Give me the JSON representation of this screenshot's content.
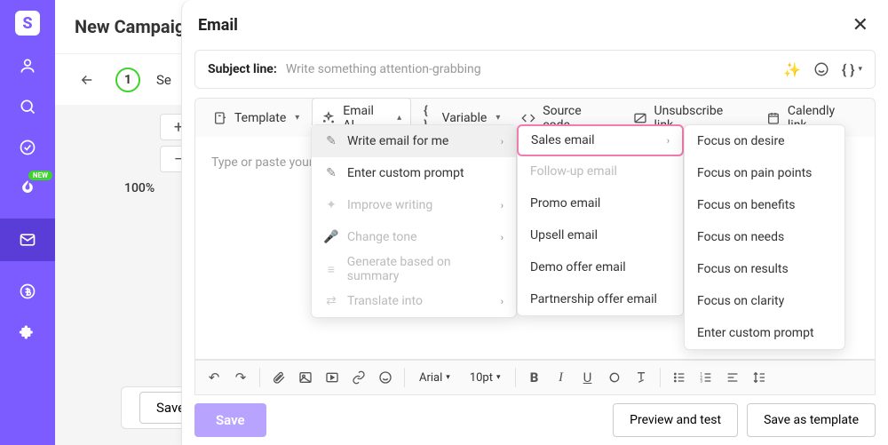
{
  "sidebar": {
    "logo": "S",
    "new_badge": "NEW"
  },
  "underlay": {
    "title": "New Campaign",
    "step_num": "1",
    "step_label": "Se",
    "zoom_label": "100%",
    "save": "Save"
  },
  "modal": {
    "title": "Email",
    "subject_label": "Subject line:",
    "subject_placeholder": "Write something attention-grabbing",
    "toolbar": {
      "template": "Template",
      "email_ai": "Email AI",
      "variable": "Variable",
      "source_code": "Source code",
      "unsubscribe": "Unsubscribe link",
      "calendly": "Calendly link"
    },
    "editor_placeholder": "Type or paste your",
    "footer": {
      "save": "Save",
      "preview": "Preview and test",
      "save_template": "Save as template"
    },
    "bottom_toolbar": {
      "font": "Arial",
      "size": "10pt"
    }
  },
  "menu1": {
    "items": [
      {
        "label": "Write email for me",
        "icon": "✎",
        "arrow": true,
        "highlighted": true
      },
      {
        "label": "Enter custom prompt",
        "icon": "✎",
        "arrow": false
      },
      {
        "label": "Improve writing",
        "icon": "✦",
        "arrow": true,
        "disabled": true
      },
      {
        "label": "Change tone",
        "icon": "🎤",
        "arrow": true,
        "disabled": true
      },
      {
        "label": "Generate based on summary",
        "icon": "≡",
        "arrow": false,
        "disabled": true
      },
      {
        "label": "Translate into",
        "icon": "⇄",
        "arrow": true,
        "disabled": true
      }
    ]
  },
  "menu2": {
    "items": [
      {
        "label": "Sales email",
        "arrow": true,
        "pink": true
      },
      {
        "label": "Follow-up email",
        "disabled": true
      },
      {
        "label": "Promo email"
      },
      {
        "label": "Upsell email"
      },
      {
        "label": "Demo offer email"
      },
      {
        "label": "Partnership offer email"
      }
    ]
  },
  "menu3": {
    "items": [
      {
        "label": "Focus on desire"
      },
      {
        "label": "Focus on pain points"
      },
      {
        "label": "Focus on benefits"
      },
      {
        "label": "Focus on needs"
      },
      {
        "label": "Focus on results"
      },
      {
        "label": "Focus on clarity"
      },
      {
        "label": "Enter custom prompt"
      }
    ]
  }
}
